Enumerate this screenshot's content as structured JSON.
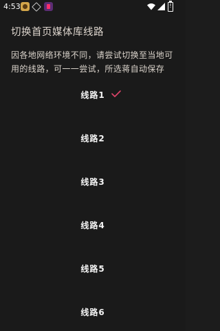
{
  "status_bar": {
    "time": "4:53",
    "battery_label": "!",
    "icons": [
      "app-notification-icon",
      "cube-icon",
      "app-notification-icon",
      "wifi-icon",
      "signal-icon",
      "battery-icon"
    ]
  },
  "page": {
    "title": "切换首页媒体库线路",
    "description": "因各地网络环境不同，请尝试切换至当地可用的线路，可一一尝试，所选蒋自动保存"
  },
  "routes": {
    "selected_index": 0,
    "items": [
      {
        "label": "线路1"
      },
      {
        "label": "线路2"
      },
      {
        "label": "线路3"
      },
      {
        "label": "线路4"
      },
      {
        "label": "线路5"
      },
      {
        "label": "线路6"
      }
    ]
  },
  "colors": {
    "background": "#1a1a1a",
    "check_accent": "#e0446a",
    "title_text": "#ded6ce",
    "route_text": "#f4f4f4"
  }
}
